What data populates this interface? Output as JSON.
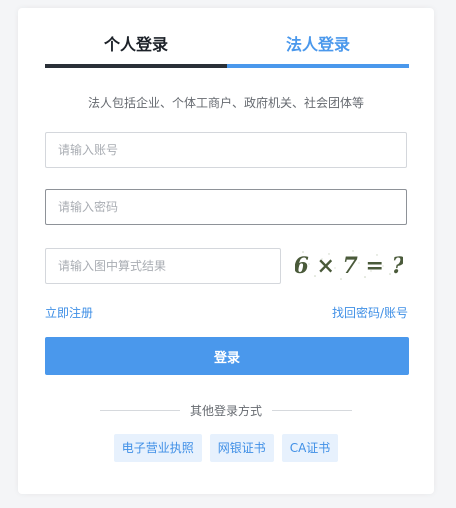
{
  "tabs": {
    "personal": "个人登录",
    "legal": "法人登录"
  },
  "description": "法人包括企业、个体工商户、政府机关、社会团体等",
  "form": {
    "account_placeholder": "请输入账号",
    "password_placeholder": "请输入密码",
    "captcha_placeholder": "请输入图中算式结果",
    "captcha_expression": "6 × 7 = ?"
  },
  "links": {
    "register": "立即注册",
    "forgot": "找回密码/账号"
  },
  "login_button": "登录",
  "other_methods": {
    "label": "其他登录方式",
    "items": [
      "电子营业执照",
      "网银证书",
      "CA证书"
    ]
  },
  "colors": {
    "accent": "#4a98ec",
    "active_tab_underline": "#2a3038",
    "method_bg": "#e7f1fd"
  }
}
